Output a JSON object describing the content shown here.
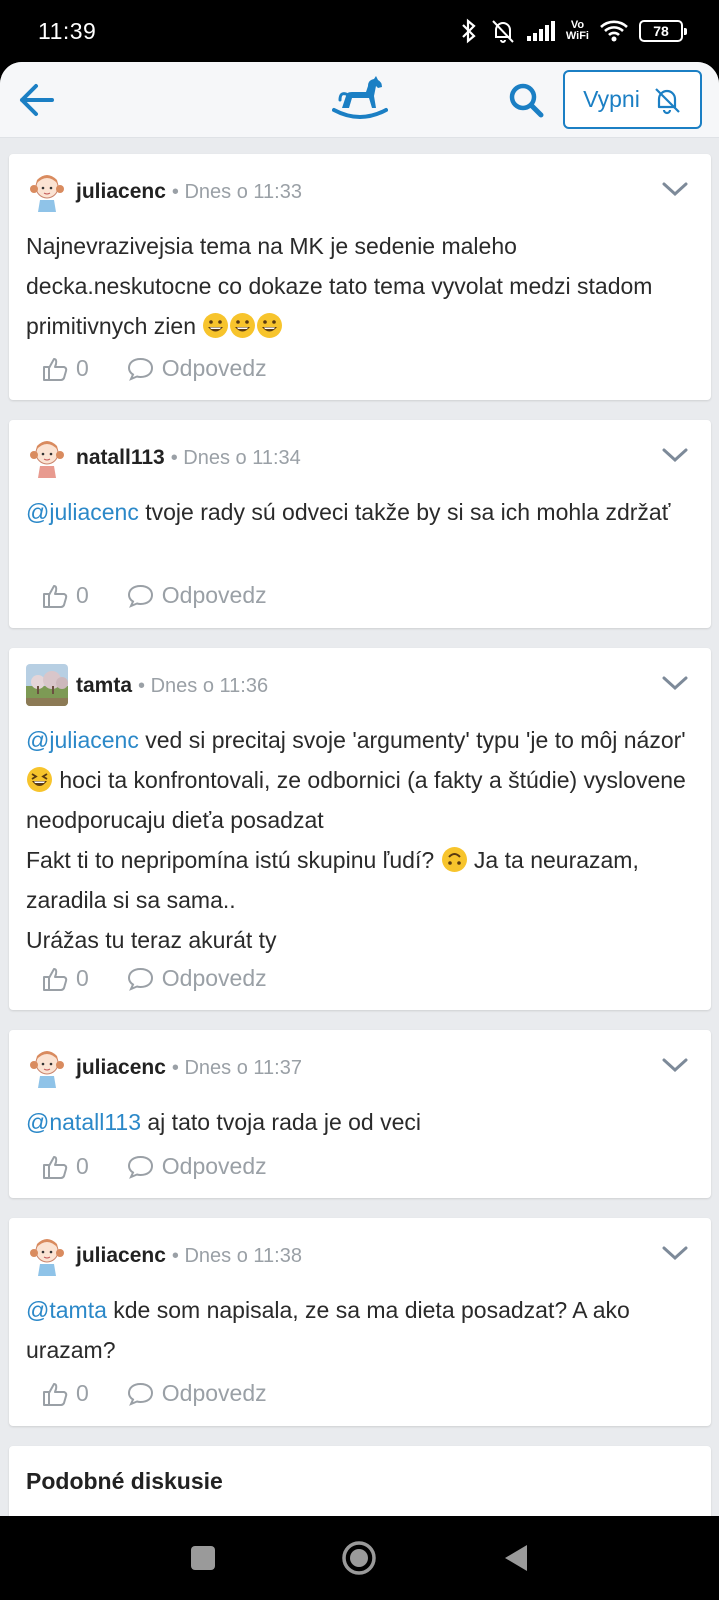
{
  "status_bar": {
    "time": "11:39",
    "vowifi_top": "Vo",
    "vowifi_bottom": "WiFi",
    "battery": "78"
  },
  "toolbar": {
    "mute_label": "Vypni"
  },
  "comments": [
    {
      "author": "juliacenc",
      "time": "Dnes o 11:33",
      "text": "Najnevrazivejsia tema na MK je sedenie maleho decka.neskutocne co dokaze tato tema vyvolat medzi stadom primitivnych zien ",
      "emojis": "grinning-x3",
      "likes": "0",
      "reply_label": "Odpovedz"
    },
    {
      "author": "natall113",
      "time": "Dnes o 11:34",
      "mention": "@juliacenc",
      "text": " tvoje rady sú odveci takže by si sa ich mohla zdržať",
      "likes": "0",
      "reply_label": "Odpovedz"
    },
    {
      "author": "tamta",
      "time": "Dnes o 11:36",
      "mention": "@juliacenc",
      "text_1": " ved si precitaj svoje 'argumenty' typu 'je to môj názor' ",
      "text_2": " hoci ta konfrontovali, ze odbornici (a fakty a štúdie) vyslovene neodporucaju dieťa posadzat",
      "text_3": "Fakt ti to nepripomína istú skupinu ľudí? ",
      "text_4": " Ja ta neurazam, zaradila si sa sama..",
      "text_5": "Urážas tu teraz akurát ty",
      "likes": "0",
      "reply_label": "Odpovedz"
    },
    {
      "author": "juliacenc",
      "time": "Dnes o 11:37",
      "mention": "@natall113",
      "text": " aj tato tvoja rada je od veci",
      "likes": "0",
      "reply_label": "Odpovedz"
    },
    {
      "author": "juliacenc",
      "time": "Dnes o 11:38",
      "mention": "@tamta",
      "text": " kde som napisala, ze sa ma dieta posadzat? A ako urazam?",
      "likes": "0",
      "reply_label": "Odpovedz"
    }
  ],
  "similar": {
    "heading": "Podobné diskusie"
  },
  "colors": {
    "accent": "#1b7fc4",
    "mention": "#2b88c8",
    "muted": "#9aa0a6",
    "background": "#e9ebee"
  }
}
